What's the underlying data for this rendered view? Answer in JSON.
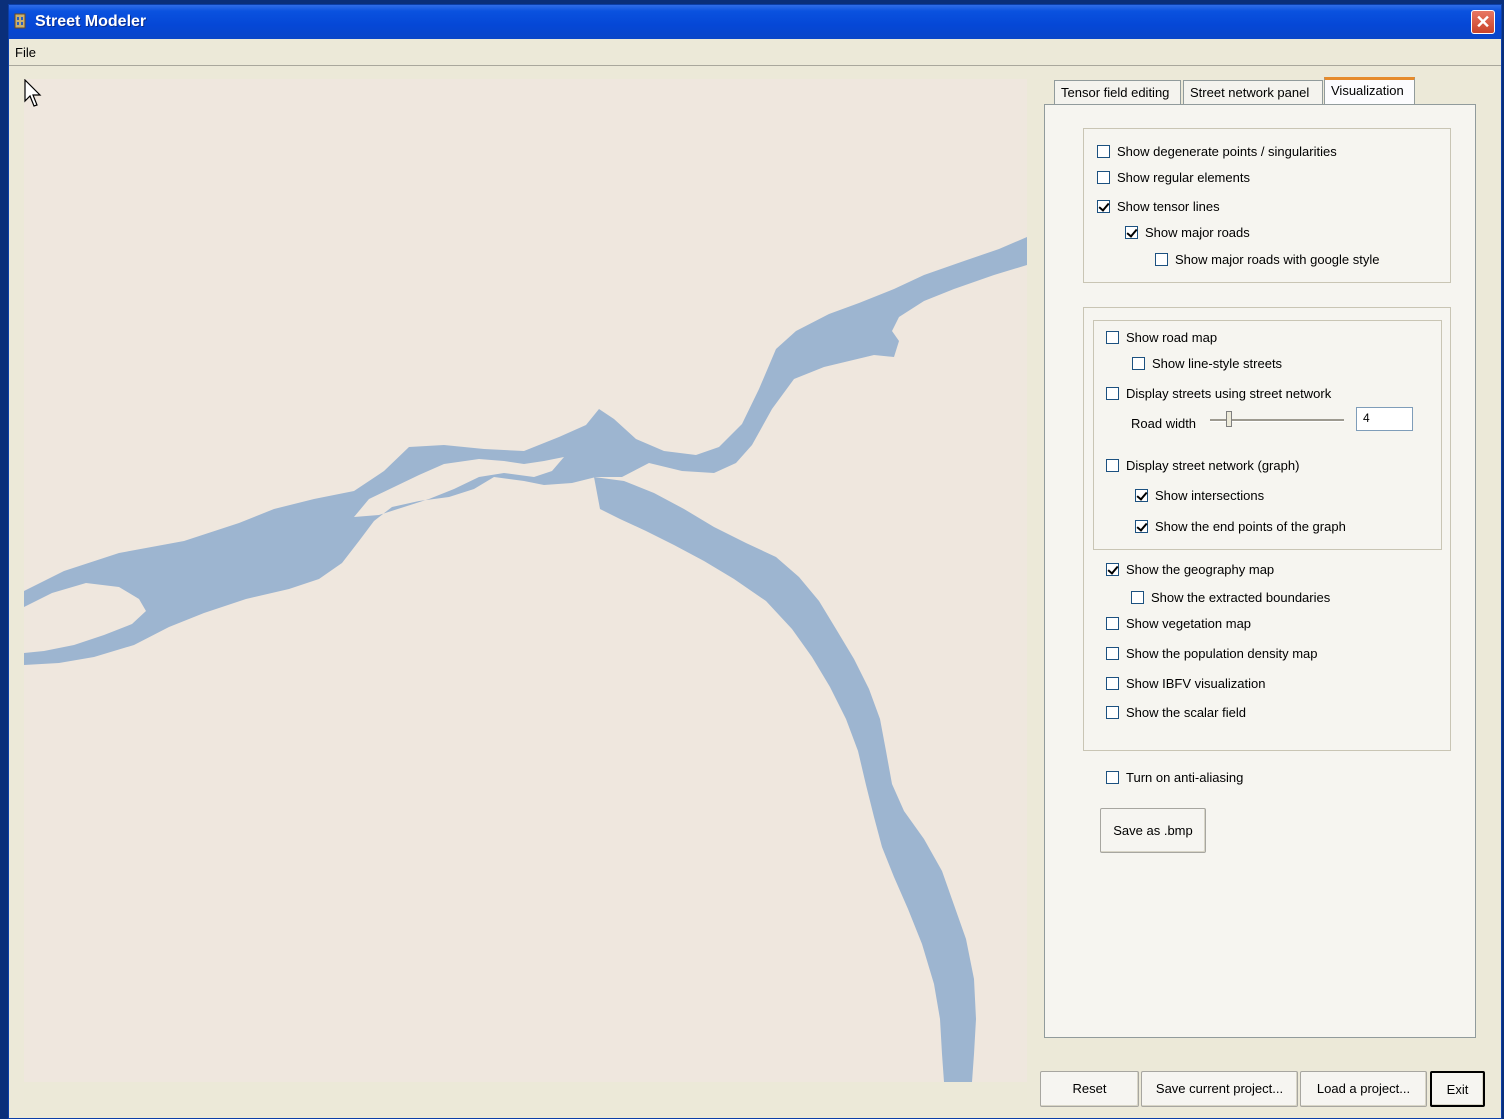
{
  "window": {
    "title": "Street Modeler"
  },
  "menu": {
    "file": "File"
  },
  "tabs": [
    {
      "label": "Tensor field editing",
      "active": false
    },
    {
      "label": "Street network panel",
      "active": false
    },
    {
      "label": "Visualization",
      "active": true
    }
  ],
  "group1": {
    "degenerate": {
      "label": "Show degenerate points / singularities",
      "checked": false
    },
    "regular": {
      "label": "Show regular elements",
      "checked": false
    },
    "tensor_lines": {
      "label": "Show tensor lines",
      "checked": true
    },
    "major_roads": {
      "label": "Show major roads",
      "checked": true
    },
    "google_style": {
      "label": "Show major roads with google style",
      "checked": false
    }
  },
  "group2": {
    "road_map": {
      "label": "Show road map",
      "checked": false
    },
    "line_style": {
      "label": "Show line-style streets",
      "checked": false
    },
    "display_streets": {
      "label": "Display streets using street network",
      "checked": false
    },
    "road_width_label": "Road width",
    "road_width_value": "4",
    "display_graph": {
      "label": "Display street network (graph)",
      "checked": false
    },
    "intersections": {
      "label": "Show intersections",
      "checked": true
    },
    "end_points": {
      "label": "Show the end points of the graph",
      "checked": true
    },
    "geography": {
      "label": "Show the geography map",
      "checked": true
    },
    "boundaries": {
      "label": "Show the extracted boundaries",
      "checked": false
    },
    "vegetation": {
      "label": "Show vegetation map",
      "checked": false
    },
    "population": {
      "label": "Show the population density map",
      "checked": false
    },
    "ibfv": {
      "label": "Show IBFV visualization",
      "checked": false
    },
    "scalar": {
      "label": "Show the scalar field",
      "checked": false
    }
  },
  "anti_aliasing": {
    "label": "Turn on anti-aliasing",
    "checked": false
  },
  "buttons": {
    "save_bmp": "Save as .bmp",
    "reset": "Reset",
    "save_project": "Save current project...",
    "load_project": "Load a project...",
    "exit": "Exit"
  },
  "colors": {
    "water": "#9db5d0",
    "land": "#efe7de",
    "titlebar": "#0a52df"
  }
}
